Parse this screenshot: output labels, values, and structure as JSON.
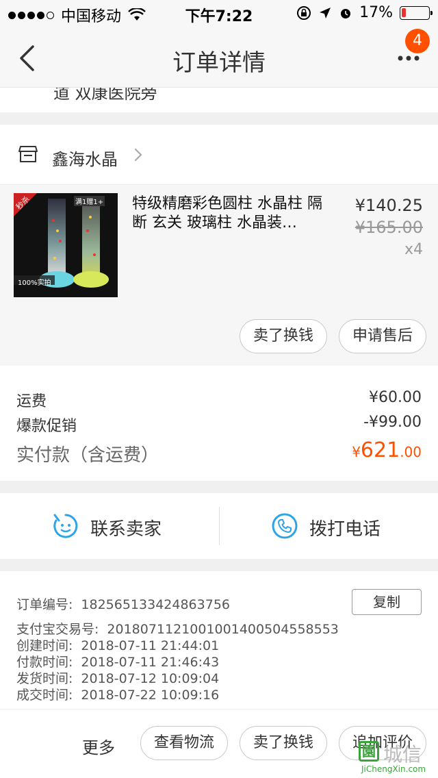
{
  "status_bar": {
    "carrier": "中国移动",
    "time": "下午7:22",
    "battery_text": "17%",
    "battery_level": 0.17,
    "colors": {
      "battery_low": "#e8322c"
    }
  },
  "nav": {
    "title": "订单详情",
    "back_icon": "chevron-left-icon",
    "more_icon": "ellipsis-icon",
    "badge": "4"
  },
  "address_partial": "道 双康医院旁",
  "shop": {
    "name": "鑫海水晶",
    "icon": "store-icon",
    "item": {
      "title": "特级精磨彩色圆柱 水晶柱 隔断 玄关 玻璃柱 水晶装…",
      "price": "¥140.25",
      "original_price": "¥165.00",
      "quantity": "x4",
      "image_tags": {
        "flash": "秒杀",
        "buy": "满1赠1+",
        "real": "100%实拍"
      }
    },
    "actions": {
      "sell": "卖了换钱",
      "after_sale": "申请售后"
    }
  },
  "fees": {
    "shipping_label": "运费",
    "shipping_value": "¥60.00",
    "promo_label": "爆款促销",
    "promo_value": "-¥99.00",
    "total_label": "实付款（含运费）",
    "total_yen": "¥",
    "total_int": "621",
    "total_dec": ".00"
  },
  "contact": {
    "seller_label": "联系卖家",
    "phone_label": "拨打电话",
    "colors": {
      "icon": "#2ea4e8"
    }
  },
  "order_info": {
    "copy_label": "复制",
    "rows": [
      {
        "key": "订单编号:",
        "value": "182565133424863756"
      },
      {
        "key": "支付宝交易号:",
        "value": "2018071121001001400504558553"
      },
      {
        "key": "创建时间:",
        "value": "2018-07-11 21:44:01"
      },
      {
        "key": "付款时间:",
        "value": "2018-07-11 21:46:43"
      },
      {
        "key": "发货时间:",
        "value": "2018-07-12 10:09:04"
      },
      {
        "key": "成交时间:",
        "value": "2018-07-22 10:09:16"
      }
    ]
  },
  "bottom": {
    "more": "更多",
    "logistics": "查看物流",
    "sell": "卖了换钱",
    "review": "追加评价"
  },
  "watermark": {
    "cn": "城信",
    "en": "JiChengXin.com",
    "box": "園"
  },
  "colors": {
    "accent": "#ff5000"
  }
}
